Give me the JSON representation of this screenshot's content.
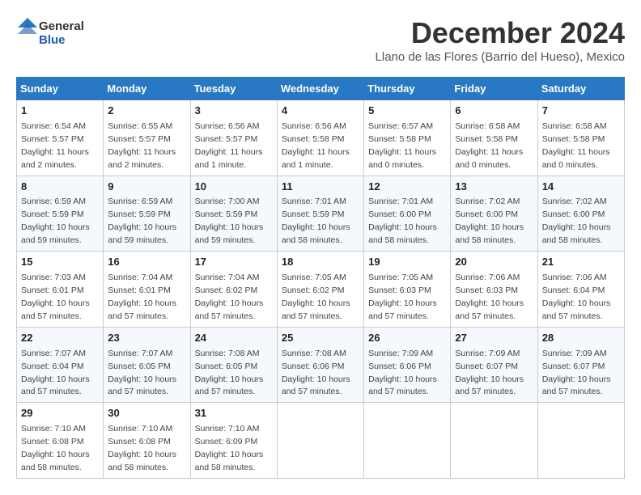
{
  "header": {
    "logo_general": "General",
    "logo_blue": "Blue",
    "month_title": "December 2024",
    "location": "Llano de las Flores (Barrio del Hueso), Mexico"
  },
  "days_of_week": [
    "Sunday",
    "Monday",
    "Tuesday",
    "Wednesday",
    "Thursday",
    "Friday",
    "Saturday"
  ],
  "weeks": [
    [
      {
        "day": "1",
        "info": "Sunrise: 6:54 AM\nSunset: 5:57 PM\nDaylight: 11 hours and 2 minutes."
      },
      {
        "day": "2",
        "info": "Sunrise: 6:55 AM\nSunset: 5:57 PM\nDaylight: 11 hours and 2 minutes."
      },
      {
        "day": "3",
        "info": "Sunrise: 6:56 AM\nSunset: 5:57 PM\nDaylight: 11 hours and 1 minute."
      },
      {
        "day": "4",
        "info": "Sunrise: 6:56 AM\nSunset: 5:58 PM\nDaylight: 11 hours and 1 minute."
      },
      {
        "day": "5",
        "info": "Sunrise: 6:57 AM\nSunset: 5:58 PM\nDaylight: 11 hours and 0 minutes."
      },
      {
        "day": "6",
        "info": "Sunrise: 6:58 AM\nSunset: 5:58 PM\nDaylight: 11 hours and 0 minutes."
      },
      {
        "day": "7",
        "info": "Sunrise: 6:58 AM\nSunset: 5:58 PM\nDaylight: 11 hours and 0 minutes."
      }
    ],
    [
      {
        "day": "8",
        "info": "Sunrise: 6:59 AM\nSunset: 5:59 PM\nDaylight: 10 hours and 59 minutes."
      },
      {
        "day": "9",
        "info": "Sunrise: 6:59 AM\nSunset: 5:59 PM\nDaylight: 10 hours and 59 minutes."
      },
      {
        "day": "10",
        "info": "Sunrise: 7:00 AM\nSunset: 5:59 PM\nDaylight: 10 hours and 59 minutes."
      },
      {
        "day": "11",
        "info": "Sunrise: 7:01 AM\nSunset: 5:59 PM\nDaylight: 10 hours and 58 minutes."
      },
      {
        "day": "12",
        "info": "Sunrise: 7:01 AM\nSunset: 6:00 PM\nDaylight: 10 hours and 58 minutes."
      },
      {
        "day": "13",
        "info": "Sunrise: 7:02 AM\nSunset: 6:00 PM\nDaylight: 10 hours and 58 minutes."
      },
      {
        "day": "14",
        "info": "Sunrise: 7:02 AM\nSunset: 6:00 PM\nDaylight: 10 hours and 58 minutes."
      }
    ],
    [
      {
        "day": "15",
        "info": "Sunrise: 7:03 AM\nSunset: 6:01 PM\nDaylight: 10 hours and 57 minutes."
      },
      {
        "day": "16",
        "info": "Sunrise: 7:04 AM\nSunset: 6:01 PM\nDaylight: 10 hours and 57 minutes."
      },
      {
        "day": "17",
        "info": "Sunrise: 7:04 AM\nSunset: 6:02 PM\nDaylight: 10 hours and 57 minutes."
      },
      {
        "day": "18",
        "info": "Sunrise: 7:05 AM\nSunset: 6:02 PM\nDaylight: 10 hours and 57 minutes."
      },
      {
        "day": "19",
        "info": "Sunrise: 7:05 AM\nSunset: 6:03 PM\nDaylight: 10 hours and 57 minutes."
      },
      {
        "day": "20",
        "info": "Sunrise: 7:06 AM\nSunset: 6:03 PM\nDaylight: 10 hours and 57 minutes."
      },
      {
        "day": "21",
        "info": "Sunrise: 7:06 AM\nSunset: 6:04 PM\nDaylight: 10 hours and 57 minutes."
      }
    ],
    [
      {
        "day": "22",
        "info": "Sunrise: 7:07 AM\nSunset: 6:04 PM\nDaylight: 10 hours and 57 minutes."
      },
      {
        "day": "23",
        "info": "Sunrise: 7:07 AM\nSunset: 6:05 PM\nDaylight: 10 hours and 57 minutes."
      },
      {
        "day": "24",
        "info": "Sunrise: 7:08 AM\nSunset: 6:05 PM\nDaylight: 10 hours and 57 minutes."
      },
      {
        "day": "25",
        "info": "Sunrise: 7:08 AM\nSunset: 6:06 PM\nDaylight: 10 hours and 57 minutes."
      },
      {
        "day": "26",
        "info": "Sunrise: 7:09 AM\nSunset: 6:06 PM\nDaylight: 10 hours and 57 minutes."
      },
      {
        "day": "27",
        "info": "Sunrise: 7:09 AM\nSunset: 6:07 PM\nDaylight: 10 hours and 57 minutes."
      },
      {
        "day": "28",
        "info": "Sunrise: 7:09 AM\nSunset: 6:07 PM\nDaylight: 10 hours and 57 minutes."
      }
    ],
    [
      {
        "day": "29",
        "info": "Sunrise: 7:10 AM\nSunset: 6:08 PM\nDaylight: 10 hours and 58 minutes."
      },
      {
        "day": "30",
        "info": "Sunrise: 7:10 AM\nSunset: 6:08 PM\nDaylight: 10 hours and 58 minutes."
      },
      {
        "day": "31",
        "info": "Sunrise: 7:10 AM\nSunset: 6:09 PM\nDaylight: 10 hours and 58 minutes."
      },
      null,
      null,
      null,
      null
    ]
  ]
}
